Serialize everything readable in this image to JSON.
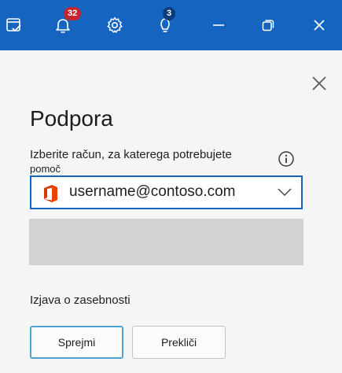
{
  "topbar": {
    "notifications_count": "32",
    "tips_count": "3",
    "colors": {
      "background": "#1565c0",
      "badge_red": "#c4262e",
      "badge_dark": "#0b3b7a"
    },
    "icons": [
      "task-check-icon",
      "bell-icon",
      "gear-icon",
      "lightbulb-icon",
      "minimize-icon",
      "restore-icon",
      "close-icon"
    ]
  },
  "panel": {
    "title": "Podpora",
    "prompt_line1": "Izberite račun, za katerega potrebujete",
    "prompt_line2": "pomoč",
    "account": {
      "email": "username@contoso.com",
      "icon": "office-logo-icon"
    },
    "privacy_link": "Izjava o zasebnosti",
    "accept_label": "Sprejmi",
    "cancel_label": "Prekliči"
  }
}
